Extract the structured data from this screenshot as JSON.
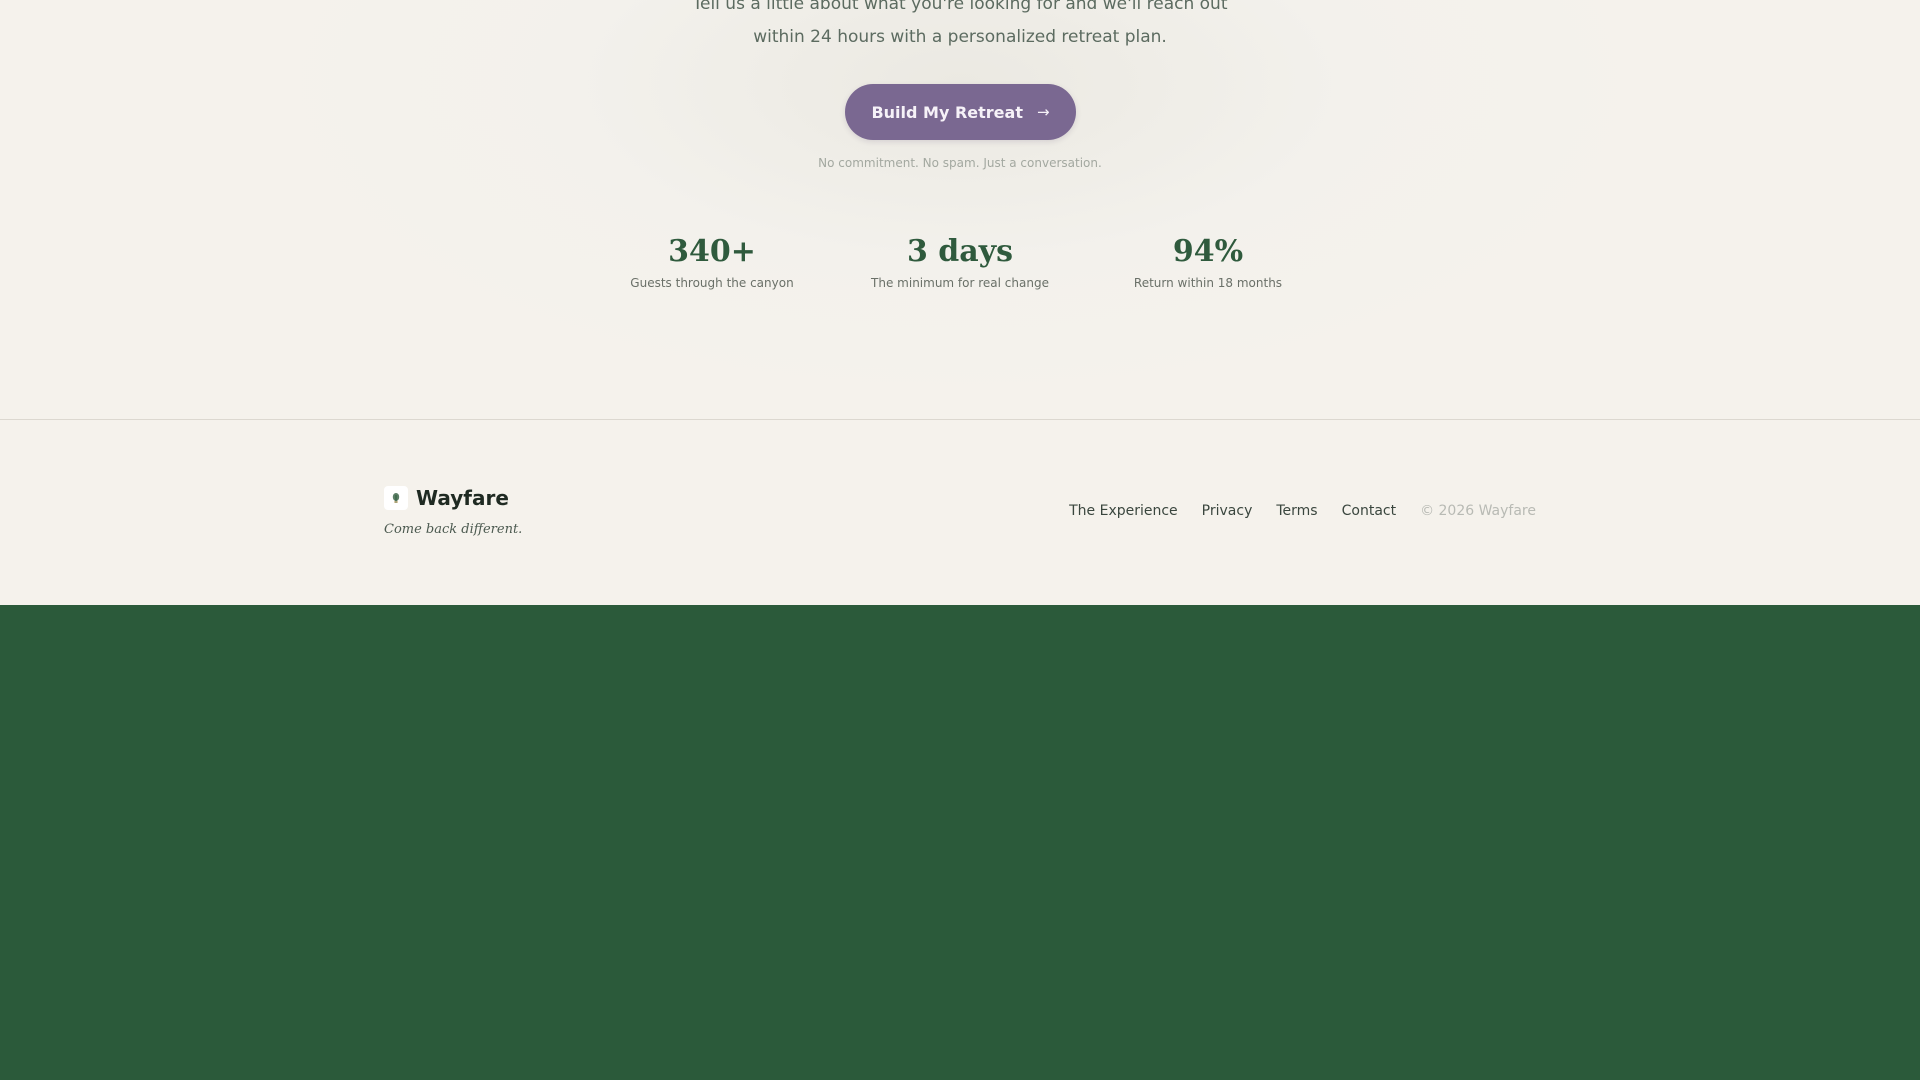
{
  "cta": {
    "intro_line_1": "Tell us a little about what you're looking for and we'll reach out",
    "intro_line_2": "within 24 hours with a personalized retreat plan.",
    "button_label": "Build My Retreat",
    "button_icon": "arrow-right-icon",
    "button_arrow": "→",
    "note": "No commitment. No spam. Just a conversation."
  },
  "stats": [
    {
      "value": "340+",
      "label": "Guests through the canyon"
    },
    {
      "value": "3 days",
      "label": "The minimum for real change"
    },
    {
      "value": "94%",
      "label": "Return within 18 months"
    }
  ],
  "footer": {
    "brand_name": "Wayfare",
    "brand_icon": "leaf-logo-icon",
    "tagline": "Come back different.",
    "links": [
      "The Experience",
      "Privacy",
      "Terms",
      "Contact"
    ],
    "copyright": "© 2026 Wayfare"
  },
  "colors": {
    "accent_purple": "#7a6891",
    "brand_green": "#2b5a3a",
    "page_cream": "#f5f2ec"
  }
}
